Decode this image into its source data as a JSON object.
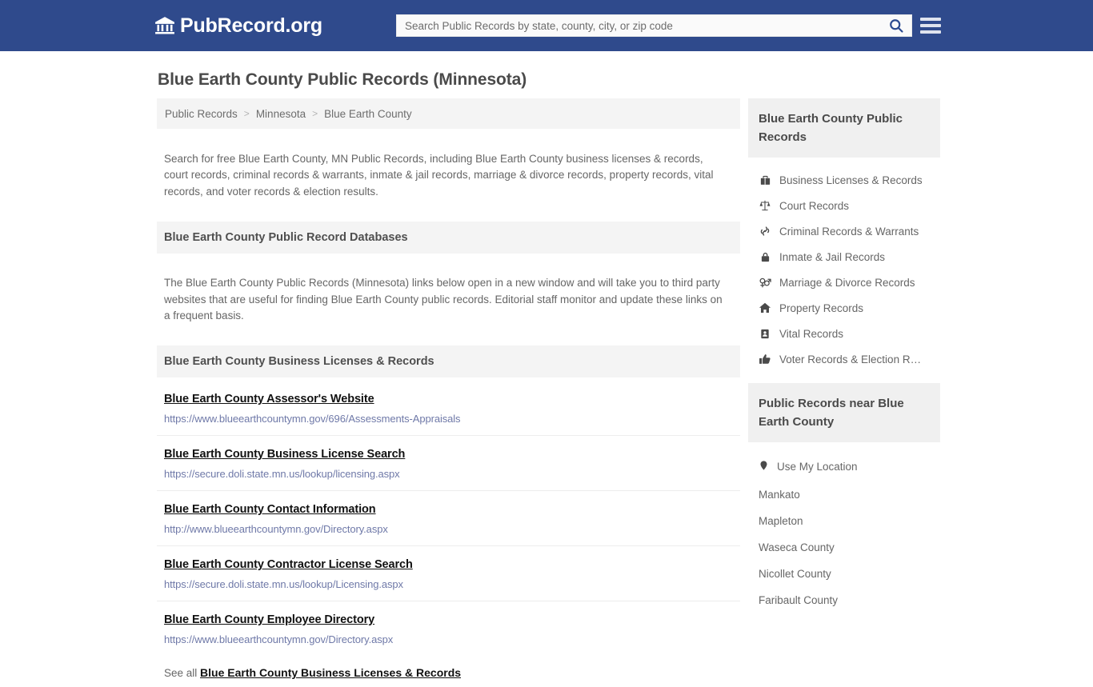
{
  "header": {
    "brand_name": "PubRecord.org",
    "brand_icon": "bank-building-icon",
    "search_placeholder": "Search Public Records by state, county, city, or zip code",
    "search_value": "",
    "search_icon": "search-icon",
    "menu_icon": "hamburger-menu-icon",
    "accent_color": "#2f4a8c"
  },
  "page": {
    "title": "Blue Earth County Public Records (Minnesota)"
  },
  "breadcrumb": {
    "items": [
      {
        "label": "Public Records"
      },
      {
        "label": "Minnesota"
      },
      {
        "label": "Blue Earth County"
      }
    ],
    "separator": ">"
  },
  "intro": {
    "text": "Search for free Blue Earth County, MN Public Records, including Blue Earth County business licenses & records, court records, criminal records & warrants, inmate & jail records, marriage & divorce records, property records, vital records, and voter records & election results."
  },
  "databases_section": {
    "heading": "Blue Earth County Public Record Databases",
    "paragraph": "The Blue Earth County Public Records (Minnesota) links below open in a new window and will take you to third party websites that are useful for finding Blue Earth County public records. Editorial staff monitor and update these links on a frequent basis."
  },
  "business_section": {
    "heading": "Blue Earth County Business Licenses & Records",
    "links": [
      {
        "title": "Blue Earth County Assessor's Website",
        "url": "https://www.blueearthcountymn.gov/696/Assessments-Appraisals"
      },
      {
        "title": "Blue Earth County Business License Search",
        "url": "https://secure.doli.state.mn.us/lookup/licensing.aspx"
      },
      {
        "title": "Blue Earth County Contact Information",
        "url": "http://www.blueearthcountymn.gov/Directory.aspx"
      },
      {
        "title": "Blue Earth County Contractor License Search",
        "url": "https://secure.doli.state.mn.us/lookup/Licensing.aspx"
      },
      {
        "title": "Blue Earth County Employee Directory",
        "url": "https://www.blueearthcountymn.gov/Directory.aspx"
      }
    ],
    "see_all_prefix": "See all",
    "see_all_link": "Blue Earth County Business Licenses & Records"
  },
  "sidebar": {
    "records_box": {
      "heading": "Blue Earth County Public Records",
      "items": [
        {
          "label": "Business Licenses & Records",
          "icon": "briefcase-icon"
        },
        {
          "label": "Court Records",
          "icon": "balance-scale-icon"
        },
        {
          "label": "Criminal Records & Warrants",
          "icon": "handcuffs-icon"
        },
        {
          "label": "Inmate & Jail Records",
          "icon": "lock-icon"
        },
        {
          "label": "Marriage & Divorce Records",
          "icon": "venus-mars-icon"
        },
        {
          "label": "Property Records",
          "icon": "home-icon"
        },
        {
          "label": "Vital Records",
          "icon": "id-card-icon"
        },
        {
          "label": "Voter Records & Election R…",
          "icon": "thumbs-up-icon"
        }
      ]
    },
    "near_box": {
      "heading": "Public Records near Blue Earth County",
      "location_item": {
        "label": "Use My Location",
        "icon": "map-pin-icon"
      },
      "items": [
        {
          "label": "Mankato"
        },
        {
          "label": "Mapleton"
        },
        {
          "label": "Waseca County"
        },
        {
          "label": "Nicollet County"
        },
        {
          "label": "Faribault County"
        }
      ]
    }
  }
}
